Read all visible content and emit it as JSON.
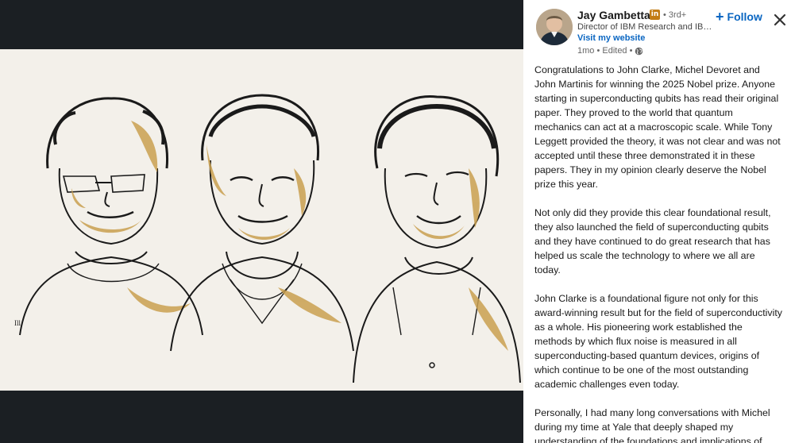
{
  "author": {
    "name": "Jay Gambetta",
    "badge": "in",
    "degree": "• 3rd+",
    "headline": "Director of IBM Research and IBM Fellow",
    "website_link": "Visit my website",
    "timestamp": "1mo • Edited •"
  },
  "actions": {
    "follow_label": "Follow",
    "follow_icon": "plus-icon",
    "close_icon": "close-icon"
  },
  "post": {
    "paragraphs": [
      "Congratulations to John Clarke, Michel Devoret and John Martinis for winning the 2025 Nobel prize. Anyone starting in superconducting qubits has read their original paper. They proved to the world that quantum mechanics can act at a macroscopic scale. While Tony Leggett provided the theory, it was not clear and was not accepted until these three demonstrated it in these papers. They in my opinion clearly deserve the Nobel prize this year.",
      "Not only did they provide this clear foundational result, they also launched the field of superconducting qubits and they have continued to do great research that has helped us scale the technology to where we all are today.",
      "John Clarke is a foundational figure not only for this award-winning result but for the field of superconductivity as a whole. His pioneering work established the methods by which flux noise is measured in all superconducting-based quantum devices, origins of which continue to be one of the most outstanding academic challenges even today.",
      "Personally, I had many long conversations with Michel during my time at Yale that deeply shaped my understanding of the foundations and implications of"
    ]
  },
  "media": {
    "image_icon": "portrait-illustration",
    "signature": "Ill."
  },
  "colors": {
    "accent": "#0a66c2",
    "badge": "#c37d16",
    "backdrop": "#1b1f23",
    "illustration_bg": "#f3f0ea",
    "gold": "#c9a050"
  }
}
